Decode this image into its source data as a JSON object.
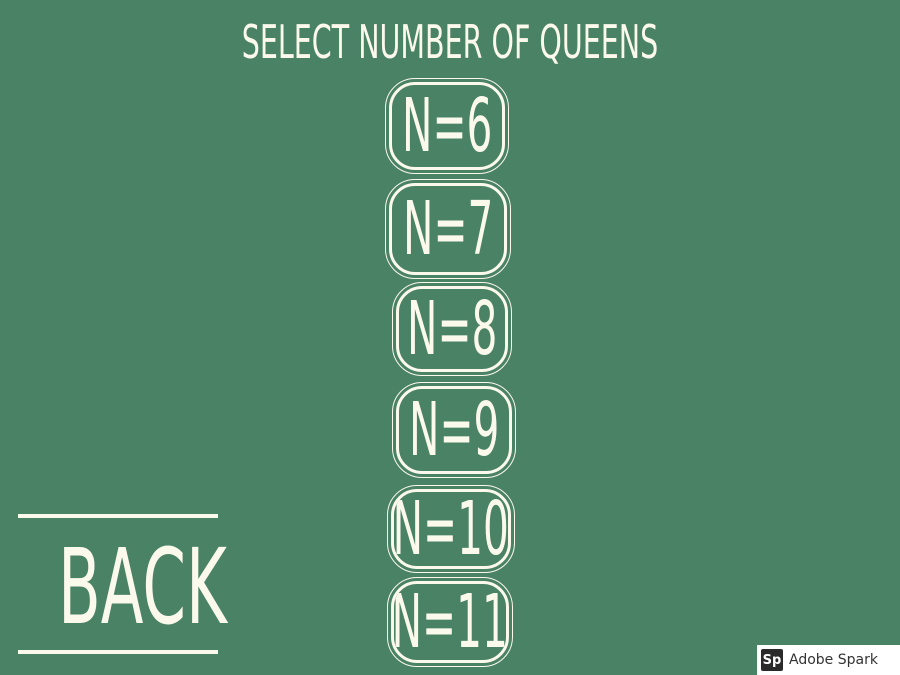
{
  "screen": {
    "title": "SELECT NUMBER OF QUEENS",
    "background_color": "#4a8266",
    "foreground_color": "#fbf8ec"
  },
  "options": [
    {
      "label": "N=6"
    },
    {
      "label": "N=7"
    },
    {
      "label": "N=8"
    },
    {
      "label": "N=9"
    },
    {
      "label": "N=10"
    },
    {
      "label": "N=11"
    }
  ],
  "back": {
    "label": "BACK"
  },
  "badge": {
    "logo": "Sp",
    "text": "Adobe Spark"
  }
}
